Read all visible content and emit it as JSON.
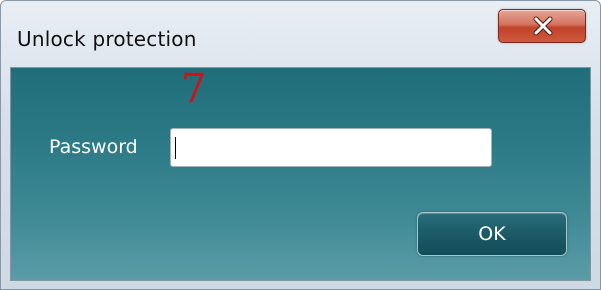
{
  "window": {
    "title": "Unlock protection",
    "close_icon": "close-icon"
  },
  "form": {
    "marker_text": "7",
    "password_label": "Password",
    "password_value": "",
    "ok_label": "OK"
  },
  "colors": {
    "client_bg": "#2b7a86",
    "ok_button_bg": "#1b5a67",
    "close_button_bg": "#c0422a",
    "marker": "#d41010"
  }
}
